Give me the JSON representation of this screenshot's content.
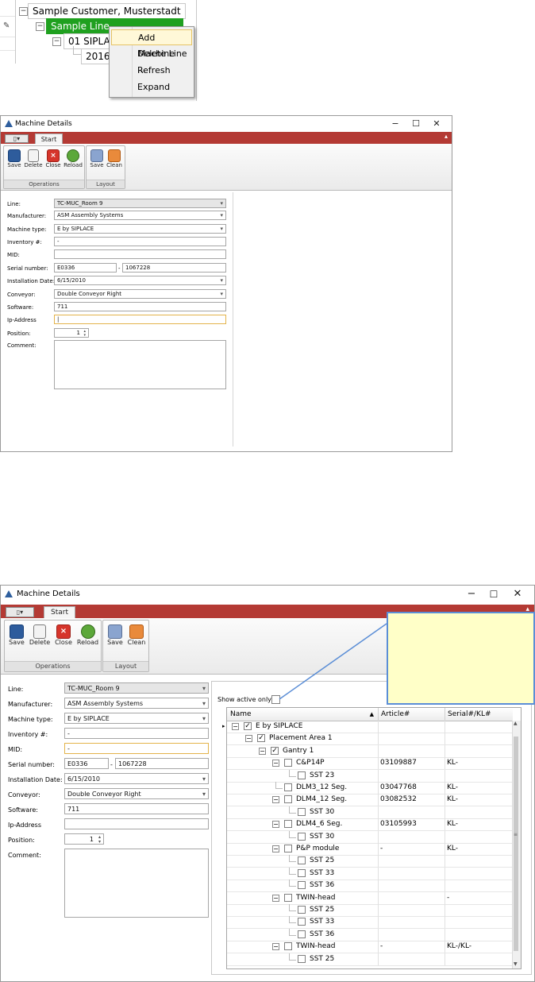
{
  "tree": {
    "customer": "Sample Customer, Musterstadt",
    "line": "Sample Line",
    "machine": "01 SIPLAC",
    "date": "2016-",
    "context_menu": [
      "Add Machine",
      "Delete Line ...",
      "Refresh",
      "Expand"
    ]
  },
  "win1": {
    "title": "Machine Details",
    "tab": "Start",
    "groups": {
      "operations": "Operations",
      "layout": "Layout"
    },
    "buttons": {
      "save": "Save",
      "delete": "Delete",
      "close": "Close",
      "reload": "Reload",
      "layout_save": "Save",
      "clean": "Clean"
    },
    "form": {
      "line_label": "Line:",
      "line_value": "TC-MUC_Room 9",
      "manufacturer_label": "Manufacturer:",
      "manufacturer_value": "ASM Assembly Systems",
      "machine_type_label": "Machine type:",
      "machine_type_value": "E by SIPLACE",
      "inventory_label": "Inventory #:",
      "inventory_value": "-",
      "mid_label": "MID:",
      "mid_value": "",
      "serial_label": "Serial number:",
      "serial_value1": "E0336",
      "serial_sep": "-",
      "serial_value2": "1067228",
      "install_label": "Installation Date:",
      "install_value": "6/15/2010",
      "conveyor_label": "Conveyor:",
      "conveyor_value": "Double Conveyor Right",
      "software_label": "Software:",
      "software_value": "711",
      "ip_label": "Ip-Address",
      "ip_value": "|",
      "position_label": "Position:",
      "position_value": "1",
      "comment_label": "Comment:"
    }
  },
  "win2": {
    "title": "Machine Details",
    "tab": "Start",
    "groups": {
      "operations": "Operations",
      "layout": "Layout"
    },
    "buttons": {
      "save": "Save",
      "delete": "Delete",
      "close": "Close",
      "reload": "Reload",
      "layout_save": "Save",
      "clean": "Clean"
    },
    "form": {
      "line_label": "Line:",
      "line_value": "TC-MUC_Room 9",
      "manufacturer_label": "Manufacturer:",
      "manufacturer_value": "ASM Assembly Systems",
      "machine_type_label": "Machine type:",
      "machine_type_value": "E by SIPLACE",
      "inventory_label": "Inventory #:",
      "inventory_value": "-",
      "mid_label": "MID:",
      "mid_value": "-",
      "serial_label": "Serial number:",
      "serial_value1": "E0336",
      "serial_sep": "-",
      "serial_value2": "1067228",
      "install_label": "Installation Date:",
      "install_value": "6/15/2010",
      "conveyor_label": "Conveyor:",
      "conveyor_value": "Double Conveyor Right",
      "software_label": "Software:",
      "software_value": "711",
      "ip_label": "Ip-Address",
      "ip_value": "",
      "position_label": "Position:",
      "position_value": "1",
      "comment_label": "Comment:"
    },
    "show_active_label": "Show active only",
    "grid_headers": [
      "Name",
      "Article#",
      "Serial#/KL#"
    ],
    "grid_rows": [
      {
        "name": "E by SIPLACE",
        "article": "",
        "serial": "",
        "checked": true
      },
      {
        "name": "Placement Area 1",
        "article": "",
        "serial": "",
        "checked": true
      },
      {
        "name": "Gantry 1",
        "article": "",
        "serial": "",
        "checked": true
      },
      {
        "name": "C&P14P",
        "article": "03109887",
        "serial": "KL-",
        "checked": false
      },
      {
        "name": "SST 23",
        "article": "",
        "serial": "",
        "checked": false
      },
      {
        "name": "DLM3_12 Seg.",
        "article": "03047768",
        "serial": "KL-",
        "checked": false
      },
      {
        "name": "DLM4_12 Seg.",
        "article": "03082532",
        "serial": "KL-",
        "checked": false
      },
      {
        "name": "SST 30",
        "article": "",
        "serial": "",
        "checked": false
      },
      {
        "name": "DLM4_6 Seg.",
        "article": "03105993",
        "serial": "KL-",
        "checked": false
      },
      {
        "name": "SST 30",
        "article": "",
        "serial": "",
        "checked": false
      },
      {
        "name": "P&P module",
        "article": "-",
        "serial": "KL-",
        "checked": false
      },
      {
        "name": "SST 25",
        "article": "",
        "serial": "",
        "checked": false
      },
      {
        "name": "SST 33",
        "article": "",
        "serial": "",
        "checked": false
      },
      {
        "name": "SST 36",
        "article": "",
        "serial": "",
        "checked": false
      },
      {
        "name": "TWIN-head",
        "article": "",
        "serial": "-",
        "checked": false
      },
      {
        "name": "SST 25",
        "article": "",
        "serial": "",
        "checked": false
      },
      {
        "name": "SST 33",
        "article": "",
        "serial": "",
        "checked": false
      },
      {
        "name": "SST 36",
        "article": "",
        "serial": "",
        "checked": false
      },
      {
        "name": "TWIN-head",
        "article": "-",
        "serial": "KL-/KL-",
        "checked": false
      },
      {
        "name": "SST 25",
        "article": "",
        "serial": "",
        "checked": false
      }
    ]
  },
  "colors": {
    "ribbon_tab": "#b43a34",
    "highlight": "#1fa01f",
    "callout": "#ffffc8",
    "callout_border": "#5b8ed6"
  }
}
